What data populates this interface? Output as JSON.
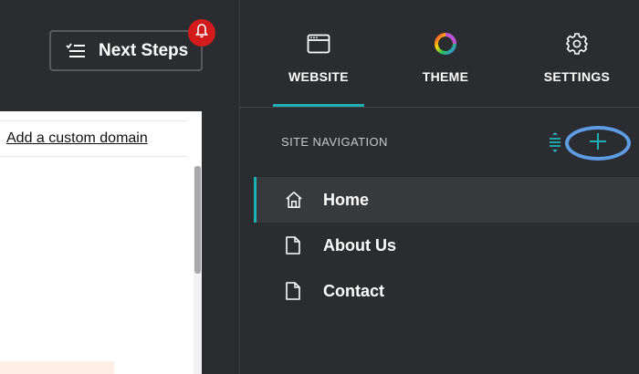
{
  "header": {
    "next_steps_label": "Next Steps"
  },
  "preview": {
    "domain_link": "Add a custom domain"
  },
  "panel": {
    "tabs": [
      {
        "label": "WEBSITE",
        "icon": "browser-window-icon",
        "active": true
      },
      {
        "label": "THEME",
        "icon": "color-wheel-icon",
        "active": false
      },
      {
        "label": "SETTINGS",
        "icon": "gear-icon",
        "active": false
      }
    ],
    "section_title": "SITE NAVIGATION",
    "nav_items": [
      {
        "label": "Home",
        "icon": "home-icon",
        "active": true
      },
      {
        "label": "About Us",
        "icon": "page-icon",
        "active": false
      },
      {
        "label": "Contact",
        "icon": "page-icon",
        "active": false
      }
    ]
  },
  "colors": {
    "accent": "#1bb1b5",
    "notification": "#d21c1c",
    "highlight_ring": "#5e9de3",
    "panel_bg": "#2b2c2f"
  }
}
